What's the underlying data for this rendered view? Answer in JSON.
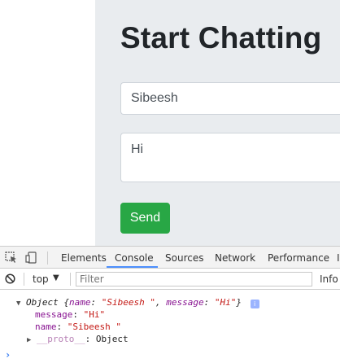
{
  "page": {
    "title": "Start Chatting",
    "name_value": "Sibeesh",
    "message_value": "Hi",
    "send_label": "Send"
  },
  "devtools": {
    "tabs": [
      "Elements",
      "Console",
      "Sources",
      "Network",
      "Performance",
      "I"
    ],
    "active_tab": "Console",
    "context": "top",
    "filter_placeholder": "Filter",
    "level": "Info",
    "log": {
      "summary_prefix": "Object {",
      "summary_name_key": "name",
      "summary_name_val": "\"Sibeesh \"",
      "summary_msg_key": "message",
      "summary_msg_val": "\"Hi\"",
      "summary_suffix": "}",
      "badge": "i",
      "prop1_key": "message",
      "prop1_val": "\"Hi\"",
      "prop2_key": "name",
      "prop2_val": "\"Sibeesh \"",
      "proto_key": "__proto__",
      "proto_val": "Object"
    },
    "prompt": "›"
  },
  "colors": {
    "jumbotron": "#e9ecef",
    "send_button": "#28a745",
    "active_tab_underline": "#4d90fe"
  }
}
